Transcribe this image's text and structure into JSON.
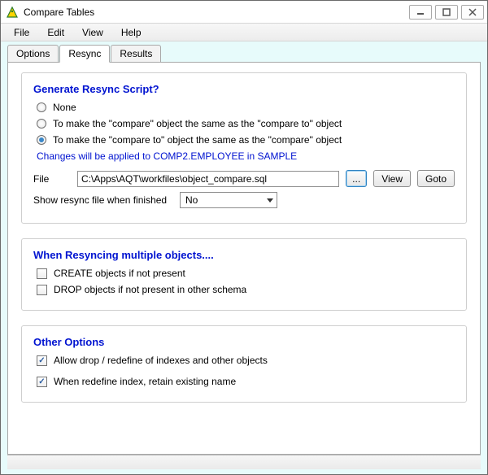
{
  "window": {
    "title": "Compare Tables"
  },
  "menu": {
    "file": "File",
    "edit": "Edit",
    "view": "View",
    "help": "Help"
  },
  "tabs": {
    "options": "Options",
    "resync": "Resync",
    "results": "Results"
  },
  "generate": {
    "title": "Generate Resync Script?",
    "opt_none": "None",
    "opt_compare_same": "To make the \"compare\" object the same as the \"compare to\" object",
    "opt_compare_to_same": "To make the \"compare to\" object the same as the \"compare\" object",
    "note": "Changes will be applied to COMP2.EMPLOYEE in SAMPLE",
    "file_label": "File",
    "file_value": "C:\\Apps\\AQT\\workfiles\\object_compare.sql",
    "browse": "...",
    "view": "View",
    "goto": "Goto",
    "show_label": "Show resync file when finished",
    "show_value": "No"
  },
  "multi": {
    "title": "When Resyncing multiple objects....",
    "create": "CREATE objects if not present",
    "drop": "DROP objects if not present in other schema"
  },
  "other": {
    "title": "Other Options",
    "allow_drop": "Allow drop / redefine of indexes and other objects",
    "retain_name": "When redefine index, retain existing name"
  }
}
